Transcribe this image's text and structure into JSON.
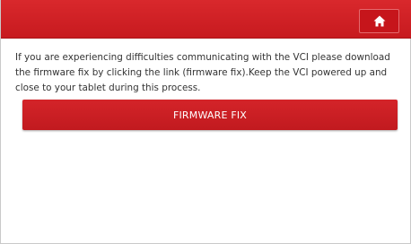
{
  "header": {
    "home_icon": "home-icon",
    "accent_color": "#d0202a"
  },
  "main": {
    "message_part1": "If you are experiencing difficulties communicating with the VCI please download the firmware fix by clicking the link (firmware fix).",
    "message_part2": "Keep the VCI powered up and close to your tablet during this process.",
    "firmware_fix_label": "FIRMWARE FIX"
  }
}
